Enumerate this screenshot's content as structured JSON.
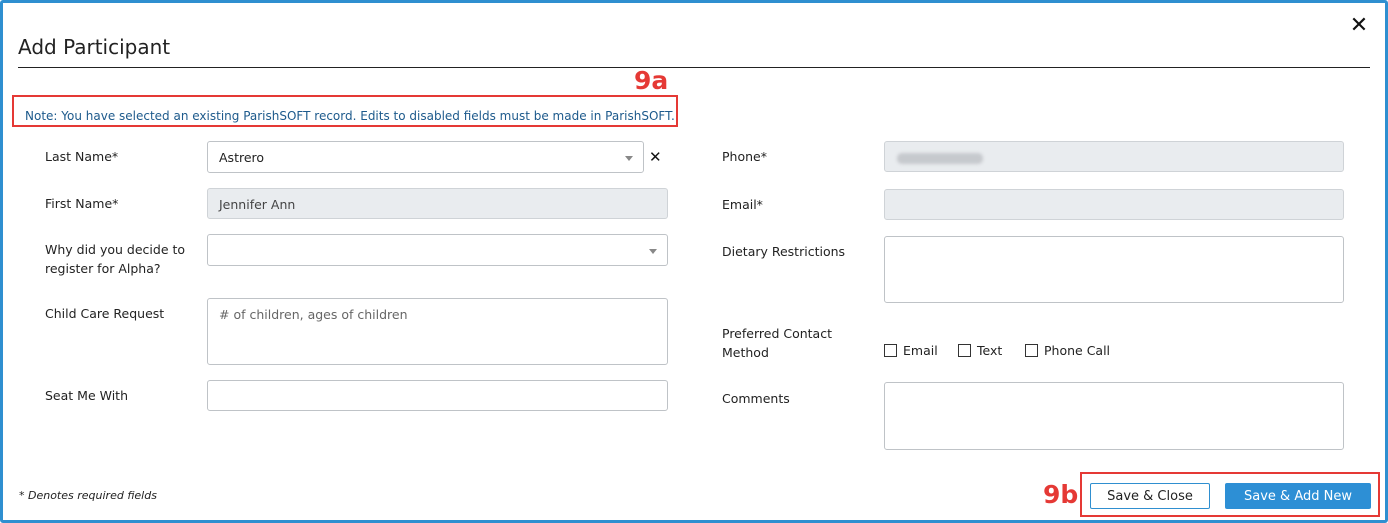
{
  "dialog": {
    "title": "Add Participant",
    "close_glyph": "✕"
  },
  "annotations": {
    "step_a": "9a",
    "step_b": "9b"
  },
  "notice": "Note: You have selected an existing ParishSOFT record. Edits to disabled fields must be made in ParishSOFT.",
  "left": {
    "last_name": {
      "label": "Last Name*",
      "value": "Astrero",
      "clear_glyph": "✕"
    },
    "first_name": {
      "label": "First Name*",
      "value": "Jennifer Ann"
    },
    "why_alpha": {
      "label_line1": "Why did you decide to",
      "label_line2": "register for Alpha?",
      "value": ""
    },
    "child_care": {
      "label": "Child Care Request",
      "placeholder": "# of children, ages of children"
    },
    "seat_with": {
      "label": "Seat Me With",
      "value": ""
    }
  },
  "right": {
    "phone": {
      "label": "Phone*"
    },
    "email": {
      "label": "Email*"
    },
    "dietary": {
      "label": "Dietary Restrictions"
    },
    "contact": {
      "label_line1": "Preferred Contact",
      "label_line2": "Method",
      "options": [
        "Email",
        "Text",
        "Phone Call"
      ]
    },
    "comments": {
      "label": "Comments"
    }
  },
  "footer": {
    "required_note": "* Denotes required fields",
    "save_close": "Save & Close",
    "save_add_new": "Save & Add New"
  },
  "colors": {
    "accent": "#2d8fd5",
    "annotation": "#e53935",
    "notice_text": "#1d5a8c",
    "disabled_bg": "#e9ecef"
  }
}
